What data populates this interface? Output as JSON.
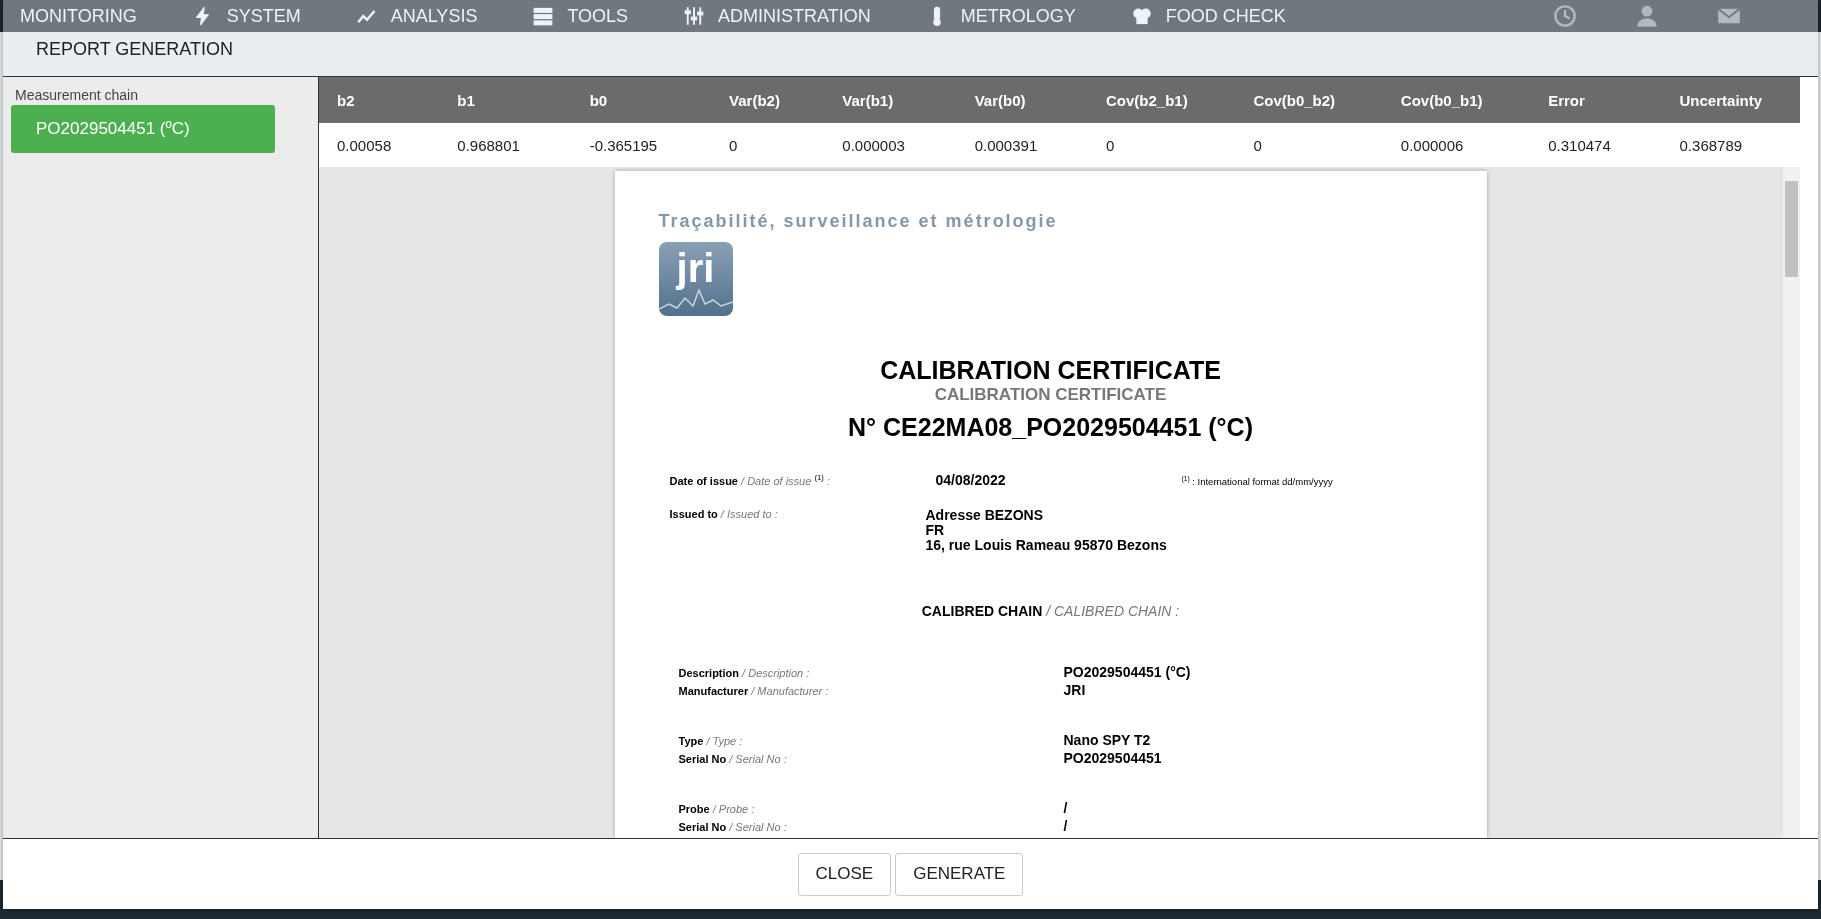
{
  "nav": {
    "items": [
      {
        "label": "MONITORING",
        "kind": "plain"
      },
      {
        "label": "SYSTEM",
        "kind": "bolt"
      },
      {
        "label": "ANALYSIS",
        "kind": "chart"
      },
      {
        "label": "TOOLS",
        "kind": "stack"
      },
      {
        "label": "ADMINISTRATION",
        "kind": "sliders"
      },
      {
        "label": "METROLOGY",
        "kind": "thermo"
      },
      {
        "label": "FOOD CHECK",
        "kind": "chef"
      }
    ]
  },
  "dialog": {
    "title": "REPORT GENERATION",
    "sidebar": {
      "label": "Measurement chain",
      "items": [
        {
          "label": "PO2029504451 (ºC)",
          "selected": true
        }
      ]
    },
    "table": {
      "columns": [
        "b2",
        "b1",
        "b0",
        "Var(b2)",
        "Var(b1)",
        "Var(b0)",
        "Cov(b2_b1)",
        "Cov(b0_b2)",
        "Cov(b0_b1)",
        "Error",
        "Uncertainty"
      ],
      "rows": [
        [
          "0.00058",
          "0.968801",
          "-0.365195",
          "0",
          "0.000003",
          "0.000391",
          "0",
          "0",
          "0.000006",
          "0.310474",
          "0.368789"
        ]
      ]
    },
    "document": {
      "tagline": "Traçabilité, surveillance et métrologie",
      "logo_text": "jri",
      "title": "CALIBRATION CERTIFICATE",
      "subtitle": "CALIBRATION CERTIFICATE",
      "number": "N° CE22MA08_PO2029504451 (°C)",
      "date_label": "**Date of issue** */ Date of issue* $^{(1)}$ *:*",
      "date_value": "04/08/2022",
      "date_note": "$^{(1)}$ : International format dd/mm/yyyy",
      "issued_label": "**Issued to** */ Issued to :*",
      "issued_lines": [
        "Adresse BEZONS",
        "FR",
        "16, rue Louis Rameau 95870 Bezons"
      ],
      "chain_heading": "**CALIBRED CHAIN** */ CALIBRED CHAIN :*",
      "chain_groups": [
        [
          {
            "label": "**Description** */ Description :*",
            "value": "PO2029504451 (°C)"
          },
          {
            "label": "**Manufacturer** */ Manufacturer :*",
            "value": "JRI"
          }
        ],
        [
          {
            "label": "**Type** */ Type :*",
            "value": "Nano SPY T2"
          },
          {
            "label": "**Serial No** */ Serial No :*",
            "value": "PO2029504451"
          }
        ],
        [
          {
            "label": "**Probe** */ Probe :*",
            "value": "/"
          },
          {
            "label": "**Serial No** */ Serial No :*",
            "value": "/"
          }
        ]
      ]
    },
    "buttons": [
      "CLOSE",
      "GENERATE"
    ]
  }
}
